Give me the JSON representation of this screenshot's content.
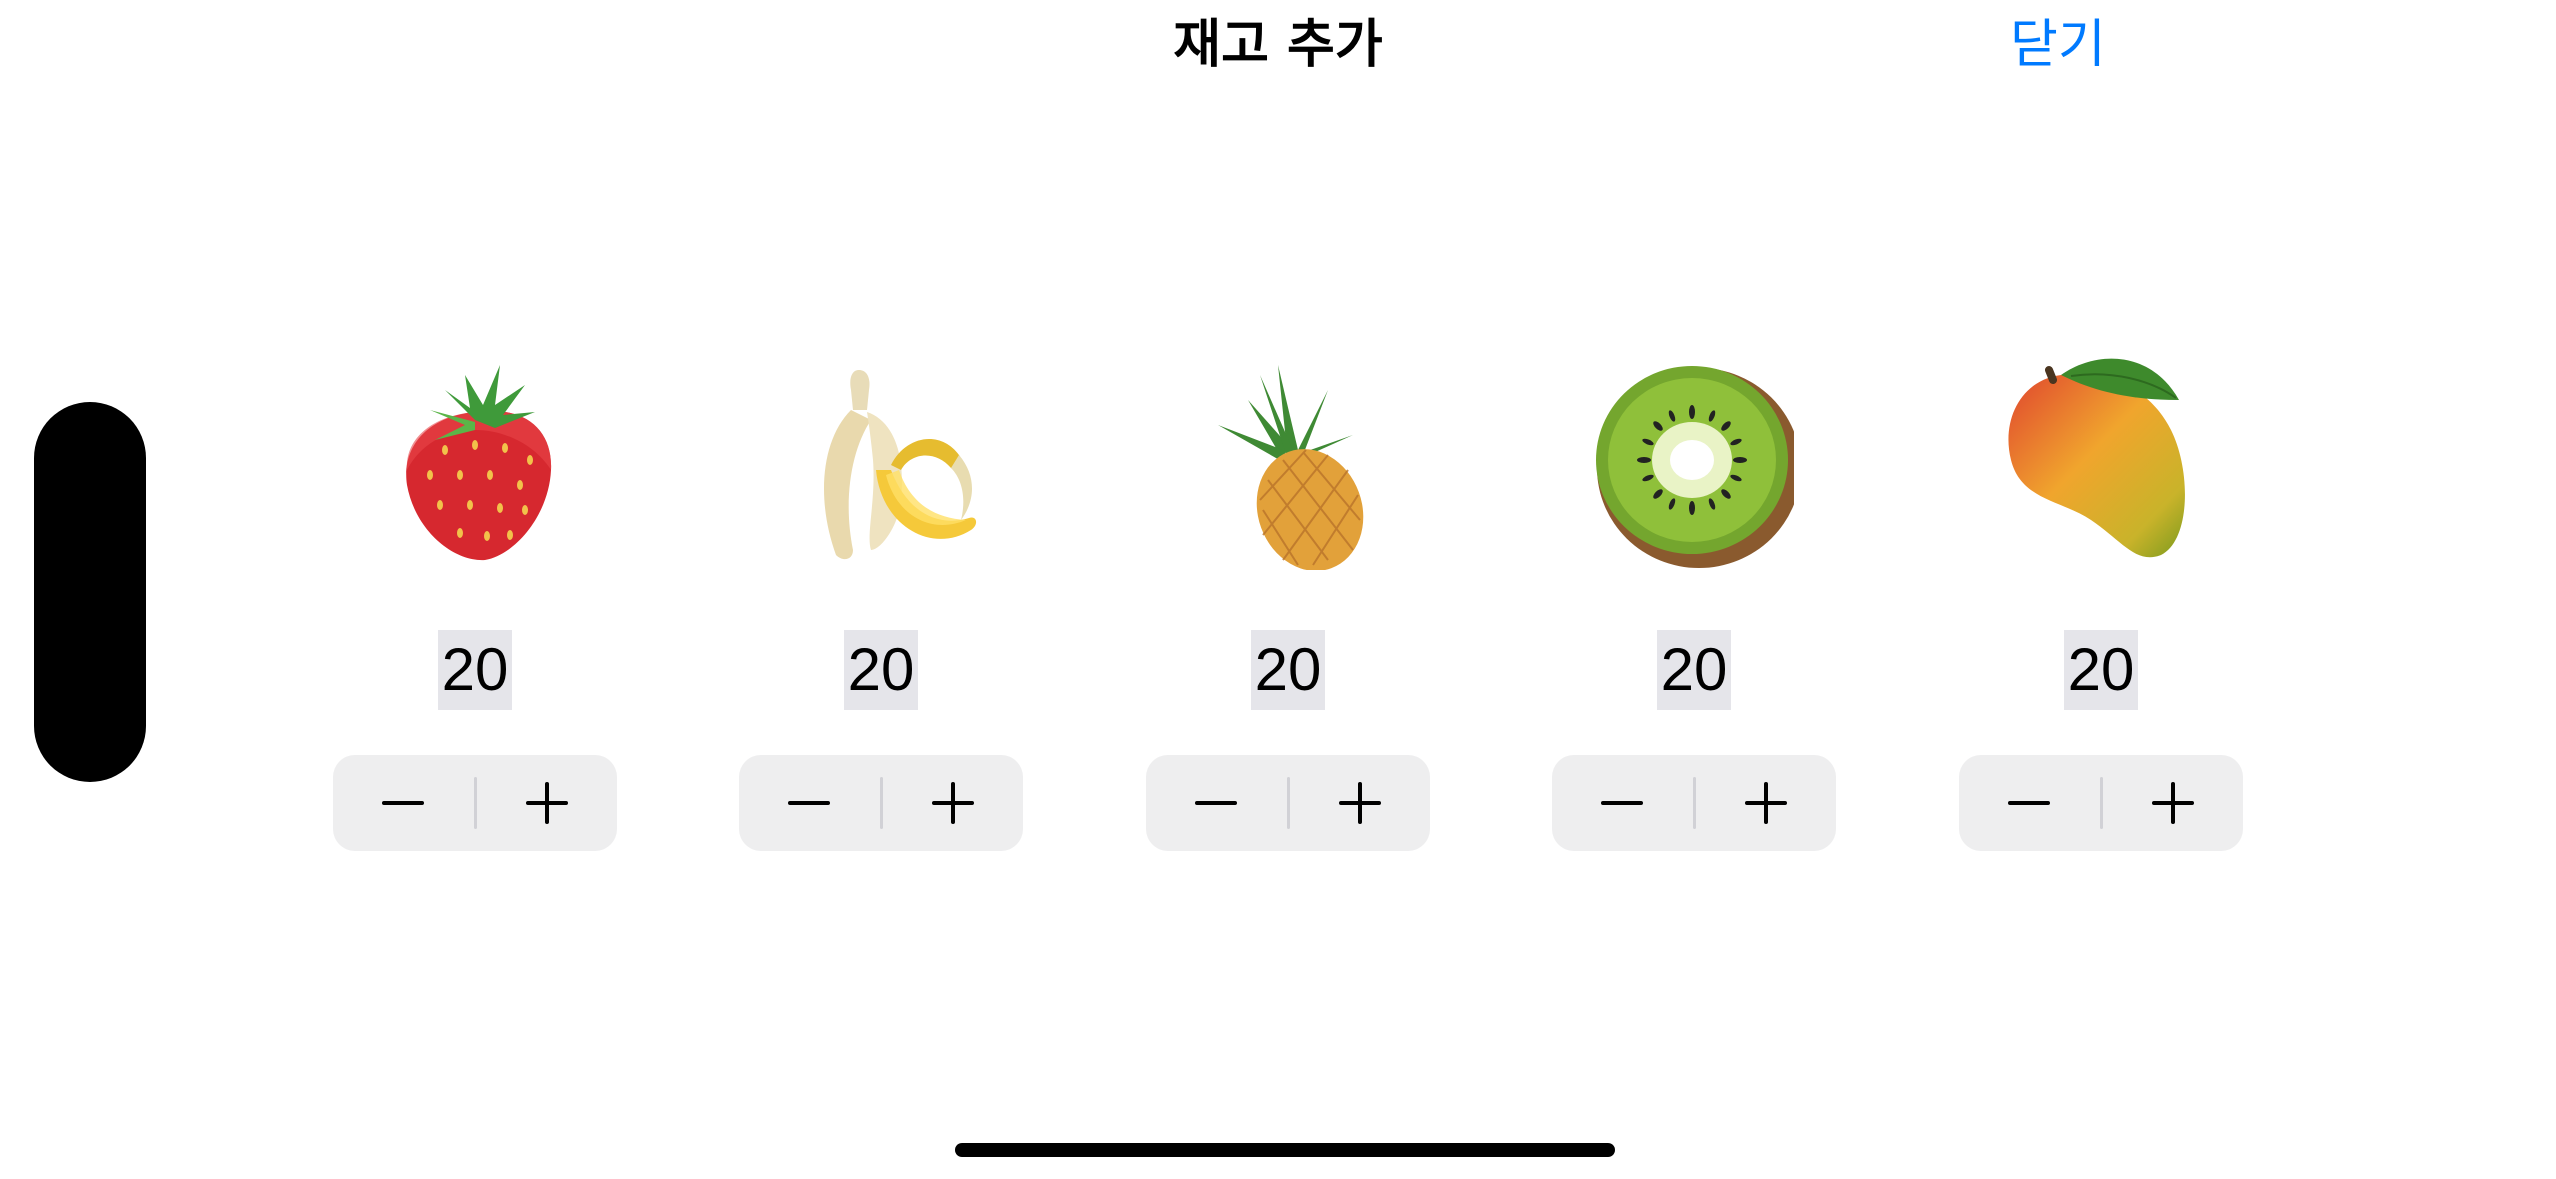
{
  "nav": {
    "title": "재고 추가",
    "close_label": "닫기"
  },
  "colors": {
    "accent": "#007aff",
    "stepper_bg": "#eeeeef",
    "quantity_highlight": "#e5e5ea"
  },
  "items": [
    {
      "icon": "strawberry-icon",
      "quantity": "20"
    },
    {
      "icon": "banana-icon",
      "quantity": "20"
    },
    {
      "icon": "pineapple-icon",
      "quantity": "20"
    },
    {
      "icon": "kiwi-icon",
      "quantity": "20"
    },
    {
      "icon": "mango-icon",
      "quantity": "20"
    }
  ]
}
